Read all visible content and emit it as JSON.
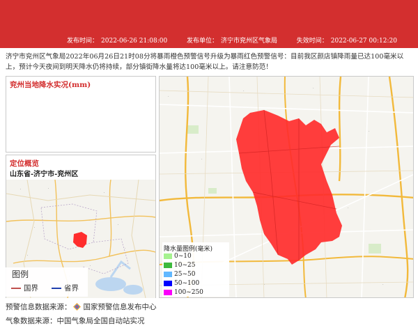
{
  "meta": {
    "publish_time_label": "发布时间：",
    "publish_time": "2022-06-26 21:08:00",
    "publisher_label": "发布单位：",
    "publisher": "济宁市兖州区气象局",
    "expire_label": "失效时间：",
    "expire_time": "2022-06-27 00:12:20"
  },
  "bulletin": {
    "text": "济宁市兖州区气象局2022年06月26日21时08分将暴雨橙色预警信号升级为暴雨红色预警信号：目前我区颜店镇降雨量已达100毫米以上，预计今天夜间到明天降水仍将持续，部分镇街降水量将达100毫米以上。请注意防范！"
  },
  "rain_panel": {
    "title": "兖州当地降水实况(mm)"
  },
  "location_panel": {
    "title": "定位概览",
    "path": "山东省-济宁市-兖州区",
    "legend": {
      "title": "图例",
      "country_border": "国界",
      "province_border": "省界",
      "country_color": "#c0504d",
      "province_color": "#1f3fae"
    }
  },
  "main_map": {
    "region_color": "#ff2d2d",
    "legend": {
      "title": "降水量图例(毫米)",
      "items": [
        {
          "label": "0~10",
          "color": "#a6f28f"
        },
        {
          "label": "10~25",
          "color": "#3dba3d"
        },
        {
          "label": "25~50",
          "color": "#61b8ff"
        },
        {
          "label": "50~100",
          "color": "#0000fe"
        },
        {
          "label": "100~250",
          "color": "#fa00fa"
        }
      ]
    }
  },
  "footer": {
    "warning_source_label": "预警信息数据来源：",
    "warning_source": "国家预警信息发布中心",
    "weather_source_label": "气象数据来源：",
    "weather_source": "中国气象局全国自动站实况"
  }
}
